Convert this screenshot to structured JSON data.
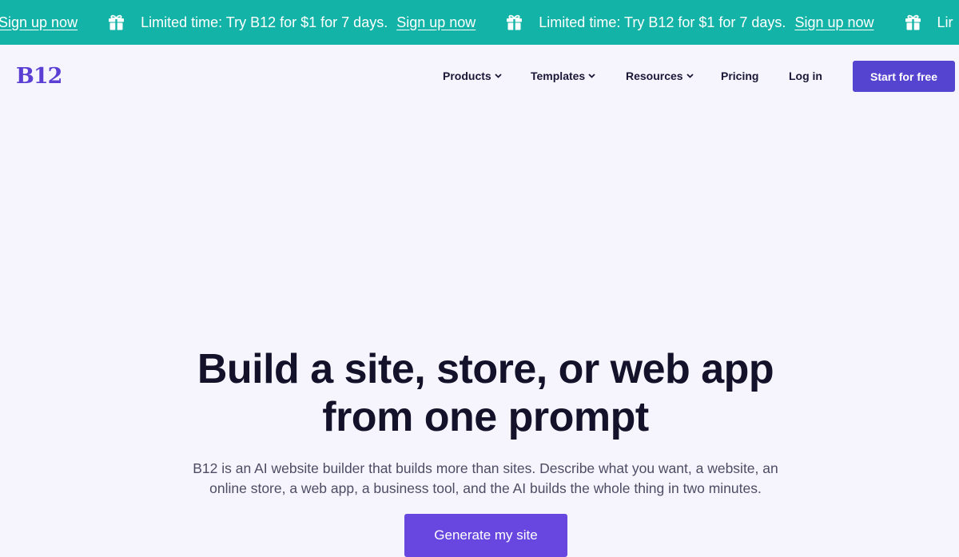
{
  "promo": {
    "message": "Limited time: Try B12 for $1 for 7 days.",
    "cta": "Sign up now",
    "partial_message": "Lir"
  },
  "header": {
    "logo": "B12",
    "nav": [
      {
        "label": "Products",
        "has_dropdown": true
      },
      {
        "label": "Templates",
        "has_dropdown": true
      },
      {
        "label": "Resources",
        "has_dropdown": true
      },
      {
        "label": "Pricing",
        "has_dropdown": false
      },
      {
        "label": "Log in",
        "has_dropdown": false
      }
    ],
    "cta": "Start for free"
  },
  "hero": {
    "title_line1": "Build a site, store, or web app",
    "title_line2": "from one prompt",
    "subtitle": "B12 is an AI website builder that builds more than sites. Describe what you want, a website, an online store, a web app, a business tool, and the AI builds the whole thing in two minutes.",
    "button": "Generate my site"
  },
  "colors": {
    "promo_bg": "#13b3a8",
    "brand": "#5b3fd4",
    "cta_bg": "#5544cf",
    "page_bg": "#f6f5fe"
  },
  "icons": {
    "promo": "gift-icon",
    "nav_dropdown": "chevron-down-icon"
  }
}
